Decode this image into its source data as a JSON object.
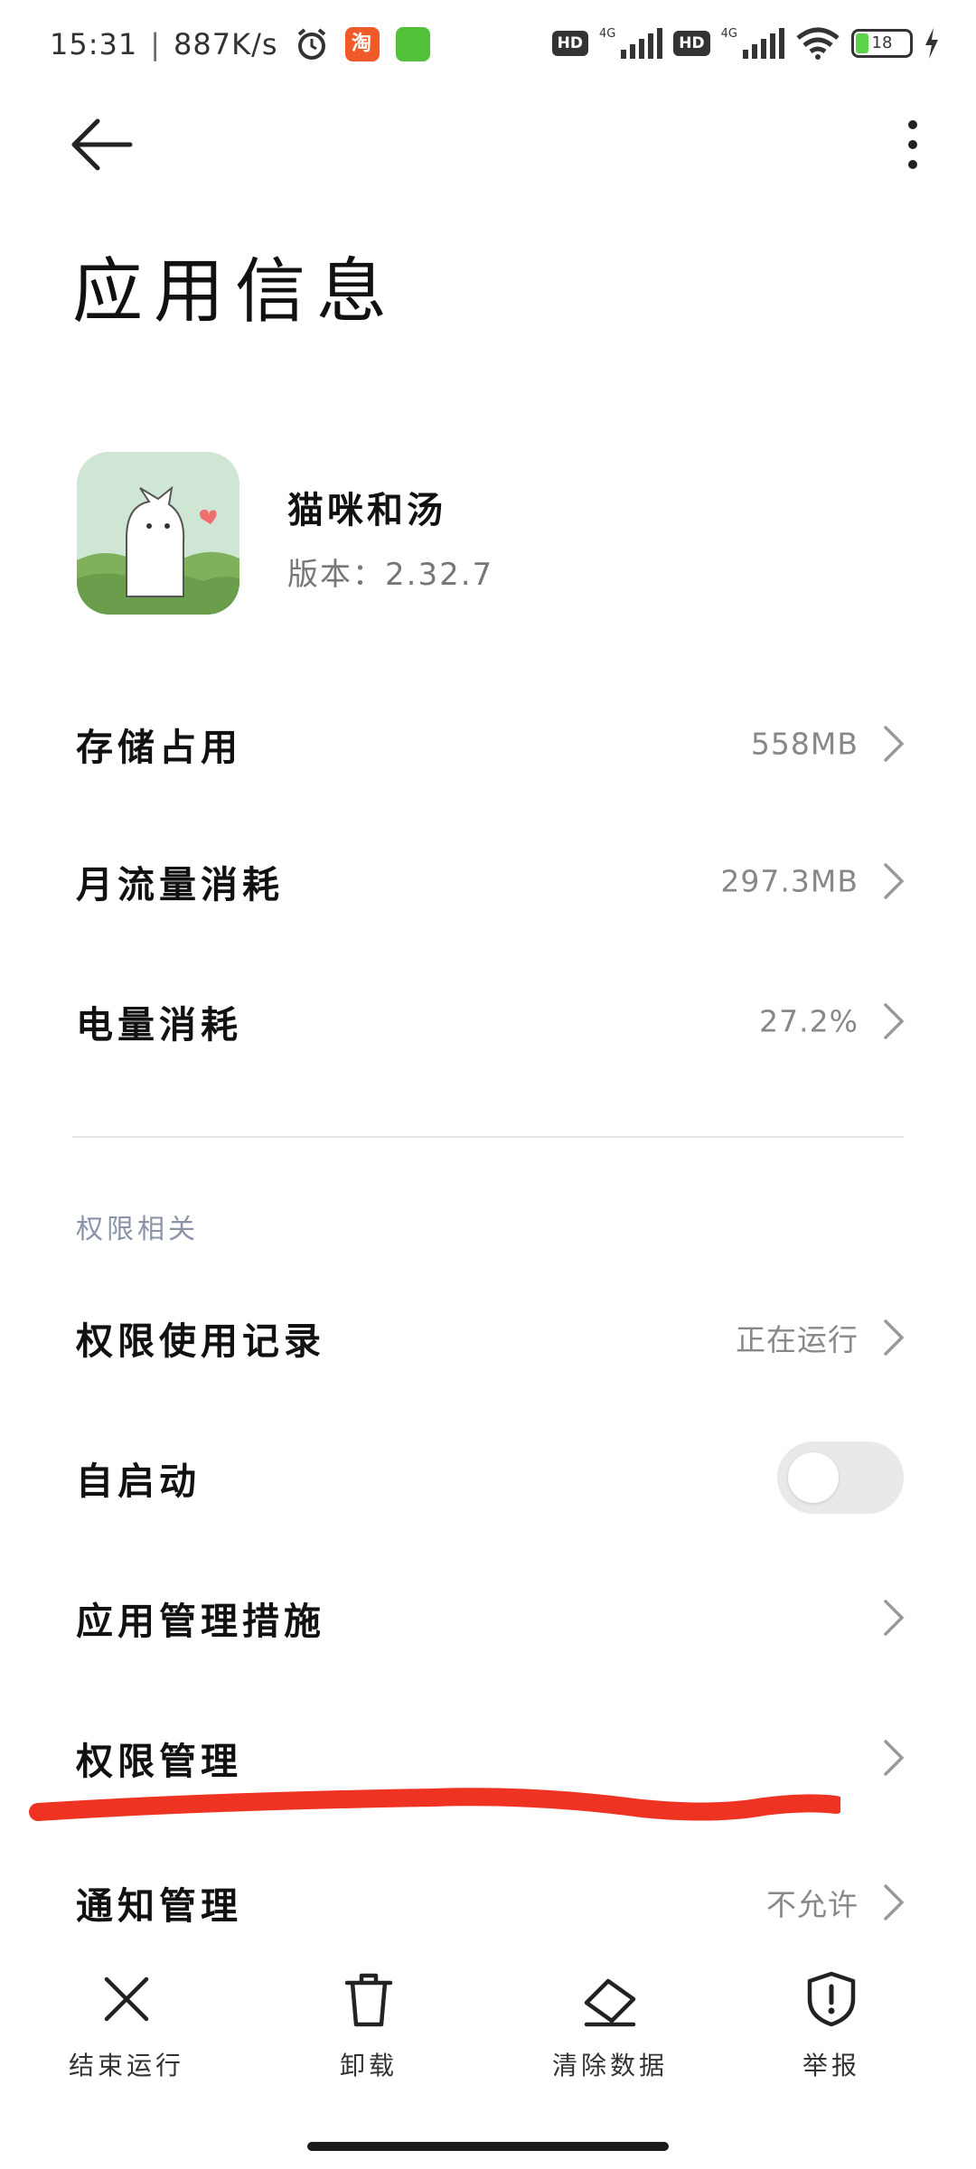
{
  "status_bar": {
    "time": "15:31",
    "speed": "887K/s",
    "taobao_label": "淘",
    "hd_label": "HD",
    "net_label": "4G",
    "battery": "18"
  },
  "page": {
    "title": "应用信息"
  },
  "app": {
    "name": "猫咪和汤",
    "version": "版本：2.32.7"
  },
  "rows": [
    {
      "label": "存储占用",
      "value": "558MB"
    },
    {
      "label": "月流量消耗",
      "value": "297.3MB"
    },
    {
      "label": "电量消耗",
      "value": "27.2%"
    }
  ],
  "section": {
    "title": "权限相关"
  },
  "perm_rows": [
    {
      "label": "权限使用记录",
      "value": "正在运行"
    },
    {
      "label": "自启动",
      "toggle": false
    },
    {
      "label": "应用管理措施",
      "value": ""
    },
    {
      "label": "权限管理",
      "value": ""
    },
    {
      "label": "通知管理",
      "value": "不允许"
    }
  ],
  "bottom_actions": [
    {
      "label": "结束运行",
      "icon": "close-icon"
    },
    {
      "label": "卸载",
      "icon": "trash-icon"
    },
    {
      "label": "清除数据",
      "icon": "eraser-icon"
    },
    {
      "label": "举报",
      "icon": "shield-alert-icon"
    }
  ],
  "colors": {
    "annotation": "#ee3322",
    "toggle_off": "#e9e9e9",
    "section": "#8a93a8"
  }
}
